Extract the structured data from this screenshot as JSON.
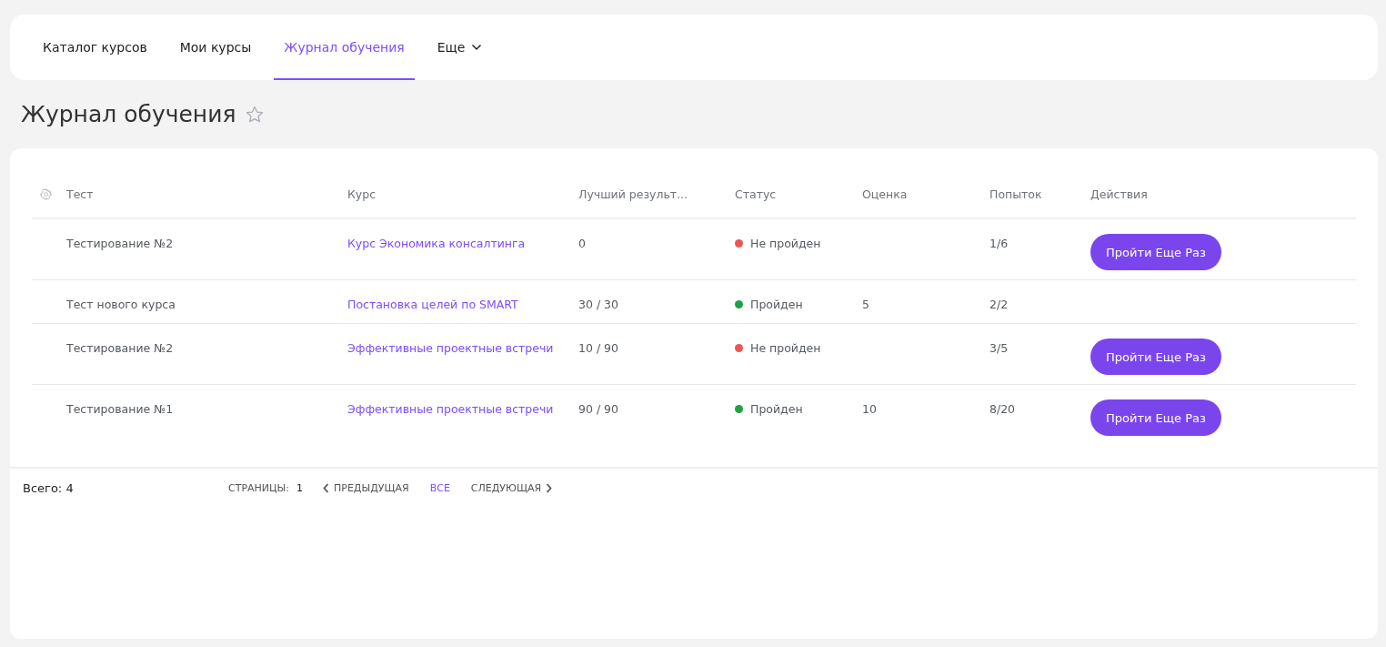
{
  "nav": {
    "tabs": [
      {
        "label": "Каталог курсов",
        "selected": false
      },
      {
        "label": "Мои курсы",
        "selected": false
      },
      {
        "label": "Журнал обучения",
        "selected": true
      },
      {
        "label": "Еще",
        "selected": false,
        "dropdown": true
      }
    ]
  },
  "page": {
    "title": "Журнал обучения",
    "favorite": false
  },
  "table": {
    "columns": [
      "Тест",
      "Курс",
      "Лучший результ...",
      "Статус",
      "Оценка",
      "Попыток",
      "Действия"
    ],
    "rows": [
      {
        "test": "Тестирование №2",
        "course": "Курс Экономика консалтинга",
        "best": "0",
        "status": {
          "label": "Не пройден",
          "color": "#f05454"
        },
        "grade": "",
        "attempts": "1/6",
        "action": "Пройти Еще Раз"
      },
      {
        "test": "Тест нового курса",
        "course": "Постановка целей по SMART",
        "best": "30 / 30",
        "status": {
          "label": "Пройден",
          "color": "#23a045"
        },
        "grade": "5",
        "attempts": "2/2",
        "action": ""
      },
      {
        "test": "Тестирование №2",
        "course": "Эффективные проектные встречи",
        "best": "10 / 90",
        "status": {
          "label": "Не пройден",
          "color": "#f05454"
        },
        "grade": "",
        "attempts": "3/5",
        "action": "Пройти Еще Раз"
      },
      {
        "test": "Тестирование №1",
        "course": "Эффективные проектные встречи",
        "best": "90 / 90",
        "status": {
          "label": "Пройден",
          "color": "#23a045"
        },
        "grade": "10",
        "attempts": "8/20",
        "action": "Пройти Еще Раз"
      }
    ]
  },
  "footer": {
    "total_label": "Всего:",
    "total_value": "4",
    "pages_label": "СТРАНИЦЫ:",
    "current_page": "1",
    "prev": "ПРЕДЫДУЩАЯ",
    "all": {
      "label": "ВСЕ",
      "selected": true
    },
    "next": "СЛЕДУЮЩАЯ"
  }
}
